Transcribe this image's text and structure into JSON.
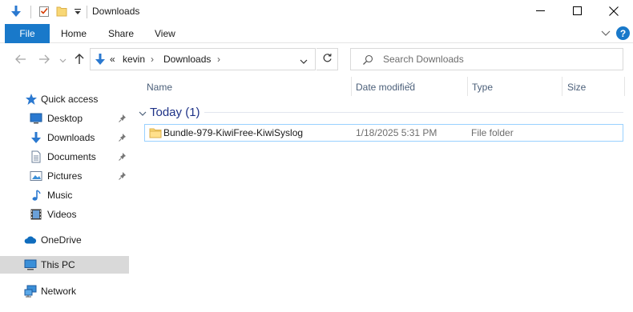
{
  "window": {
    "title": "Downloads"
  },
  "quick_access_icons": [
    "download-arrow-icon",
    "properties-checklist-icon",
    "new-folder-icon",
    "customize-toolbar-dropdown-icon"
  ],
  "window_controls": [
    "minimize-icon",
    "maximize-icon",
    "close-icon"
  ],
  "ribbon": {
    "file": "File",
    "tabs": [
      "Home",
      "Share",
      "View"
    ],
    "help": "?"
  },
  "address": {
    "overflow": "«",
    "crumbs": [
      "kevin",
      "Downloads"
    ]
  },
  "search": {
    "placeholder": "Search Downloads"
  },
  "sidebar": {
    "quick_access": "Quick access",
    "items": [
      {
        "label": "Desktop",
        "icon": "desktop-icon",
        "pinned": true
      },
      {
        "label": "Downloads",
        "icon": "downloads-icon",
        "pinned": true
      },
      {
        "label": "Documents",
        "icon": "documents-icon",
        "pinned": true
      },
      {
        "label": "Pictures",
        "icon": "pictures-icon",
        "pinned": true
      },
      {
        "label": "Music",
        "icon": "music-icon",
        "pinned": false
      },
      {
        "label": "Videos",
        "icon": "videos-icon",
        "pinned": false
      }
    ],
    "onedrive": "OneDrive",
    "this_pc": "This PC",
    "network": "Network"
  },
  "columns": {
    "name": "Name",
    "date_modified": "Date modified",
    "type": "Type",
    "size": "Size"
  },
  "group": {
    "label": "Today (1)"
  },
  "files": [
    {
      "name": "Bundle-979-KiwiFree-KiwiSyslog",
      "date_modified": "1/18/2025 5:31 PM",
      "type": "File folder",
      "size": ""
    }
  ],
  "colors": {
    "accent": "#1979ca",
    "selection_border": "#99d1ff",
    "group_text": "#1e3287",
    "header_text": "#4c607a",
    "selected_nav_bg": "#d9d9d9"
  }
}
